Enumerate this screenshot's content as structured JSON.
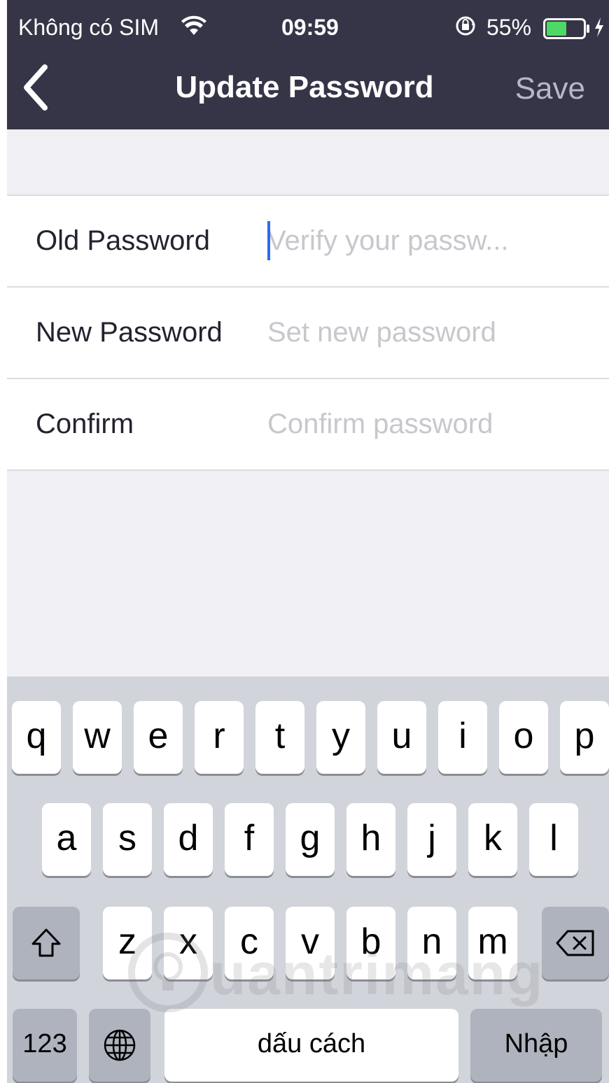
{
  "status_bar": {
    "carrier": "Không có SIM",
    "time": "09:59",
    "battery_percent": "55%",
    "battery_level": 0.55,
    "icons": [
      "wifi-icon",
      "orientation-lock-icon",
      "battery-icon",
      "charging-icon"
    ]
  },
  "nav": {
    "back_icon": "chevron-left-icon",
    "title": "Update Password",
    "save_label": "Save"
  },
  "form": {
    "fields": [
      {
        "label": "Old Password",
        "placeholder": "Verify your passw...",
        "value": ""
      },
      {
        "label": "New Password",
        "placeholder": "Set new password",
        "value": ""
      },
      {
        "label": "Confirm",
        "placeholder": "Confirm password",
        "value": ""
      }
    ]
  },
  "keyboard": {
    "row1": [
      "q",
      "w",
      "e",
      "r",
      "t",
      "y",
      "u",
      "i",
      "o",
      "p"
    ],
    "row2": [
      "a",
      "s",
      "d",
      "f",
      "g",
      "h",
      "j",
      "k",
      "l"
    ],
    "row3": [
      "z",
      "x",
      "c",
      "v",
      "b",
      "n",
      "m"
    ],
    "numbers_label": "123",
    "space_label": "dấu cách",
    "return_label": "Nhập",
    "icons": [
      "shift-icon",
      "backspace-icon",
      "globe-icon"
    ]
  },
  "watermark": {
    "text": "uantrimang",
    "icon": "lightbulb-logo-icon"
  },
  "colors": {
    "header_bg": "#363548",
    "save_disabled": "#b7b7c6",
    "caret": "#2f6af0",
    "keyboard_bg": "#d1d4da"
  }
}
